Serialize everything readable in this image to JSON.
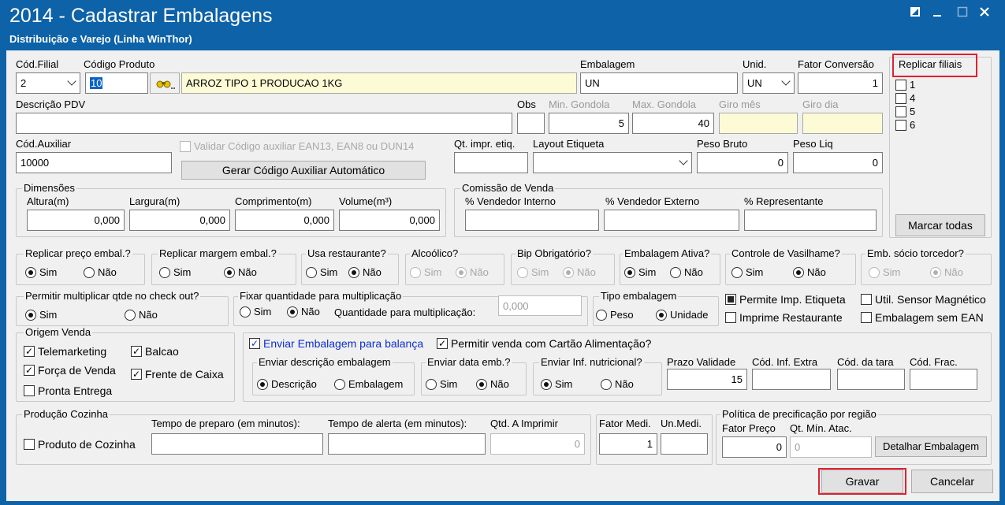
{
  "window": {
    "title": "2014 - Cadastrar Embalagens",
    "subtitle": "Distribuição e Varejo (Linha WinThor)"
  },
  "top": {
    "cod_filial_label": "Cód.Filial",
    "cod_filial_value": "2",
    "codigo_produto_label": "Código Produto",
    "codigo_produto_value": "10",
    "produto_descricao": "ARROZ TIPO 1 PRODUCAO 1KG",
    "embalagem_label": "Embalagem",
    "embalagem_value": "UN",
    "unid_label": "Unid.",
    "unid_value": "UN",
    "fator_conversao_label": "Fator Conversão",
    "fator_conversao_value": "1"
  },
  "replicar_filiais": {
    "label": "Replicar filiais",
    "filiais": [
      "1",
      "4",
      "5",
      "6"
    ],
    "marcar_todas": "Marcar todas"
  },
  "row2": {
    "descricao_pdv_label": "Descrição PDV",
    "descricao_pdv_value": "",
    "obs_label": "Obs",
    "min_gondola_label": "Min. Gondola",
    "min_gondola_value": "5",
    "max_gondola_label": "Max. Gondola",
    "max_gondola_value": "40",
    "giro_mes_label": "Giro mês",
    "giro_dia_label": "Giro dia"
  },
  "row3": {
    "cod_auxiliar_label": "Cód.Auxiliar",
    "cod_auxiliar_value": "10000",
    "validar_label": "Validar Código auxiliar EAN13, EAN8 ou DUN14",
    "gerar_button": "Gerar Código Auxiliar Automático",
    "qt_impr_label": "Qt. impr. etiq.",
    "layout_etiqueta_label": "Layout Etiqueta",
    "peso_bruto_label": "Peso Bruto",
    "peso_bruto_value": "0",
    "peso_liq_label": "Peso Liq",
    "peso_liq_value": "0"
  },
  "dimensoes": {
    "title": "Dimensões",
    "altura_label": "Altura(m)",
    "altura_value": "0,000",
    "largura_label": "Largura(m)",
    "largura_value": "0,000",
    "comprimento_label": "Comprimento(m)",
    "comprimento_value": "0,000",
    "volume_label": "Volume(m³)",
    "volume_value": "0,000"
  },
  "comissao": {
    "title": "Comissão de Venda",
    "vend_interno_label": "% Vendedor Interno",
    "vend_externo_label": "% Vendedor Externo",
    "representante_label": "% Representante"
  },
  "options": {
    "sim": "Sim",
    "nao": "Não",
    "replicar_preco": "Replicar preço embal.?",
    "replicar_margem": "Replicar margem embal.?",
    "usa_restaurante": "Usa restaurante?",
    "alcoolico": "Alcoólico?",
    "bip_obrigatorio": "Bip Obrigatório?",
    "embalagem_ativa": "Embalagem Ativa?",
    "controle_vasilhame": "Controle de Vasilhame?",
    "emb_socio_torcedor": "Emb. sócio torcedor?",
    "permitir_multiplicar": "Permitir multiplicar qtde no check out?",
    "fixar_quantidade": "Fixar quantidade para multiplicação",
    "quantidade_multiplicacao_label": "Quantidade para multiplicação:",
    "quantidade_multiplicacao_value": "0,000",
    "tipo_embalagem": "Tipo embalagem",
    "peso": "Peso",
    "unidade": "Unidade",
    "permite_imp_etiqueta": "Permite Imp. Etiqueta",
    "util_sensor": "Util. Sensor Magnético",
    "imprime_restaurante": "Imprime Restaurante",
    "embalagem_sem_ean": "Embalagem sem EAN"
  },
  "origem_venda": {
    "title": "Origem Venda",
    "telemarketing": "Telemarketing",
    "balcao": "Balcao",
    "forca_venda": "Força de Venda",
    "frente_caixa": "Frente de Caixa",
    "pronta_entrega": "Pronta Entrega"
  },
  "balanca": {
    "enviar_embalagem": "Enviar Embalagem para balança",
    "permitir_cartao": "Permitir venda com Cartão Alimentação?",
    "enviar_descricao": "Enviar descrição embalagem",
    "descricao": "Descrição",
    "embalagem": "Embalagem",
    "enviar_data": "Enviar data emb.?",
    "enviar_nutricional": "Enviar Inf. nutricional?",
    "prazo_validade_label": "Prazo Validade",
    "prazo_validade_value": "15",
    "cod_inf_extra_label": "Cód. Inf. Extra",
    "cod_tara_label": "Cód. da tara",
    "cod_frac_label": "Cód. Frac."
  },
  "producao": {
    "title": "Produção Cozinha",
    "produto_cozinha": "Produto de Cozinha",
    "tempo_preparo_label": "Tempo de preparo (em minutos):",
    "tempo_alerta_label": "Tempo de alerta (em minutos):",
    "qtd_imprimir_label": "Qtd. A Imprimir",
    "qtd_imprimir_value": "0",
    "fator_medi_label": "Fator Medi.",
    "fator_medi_value": "1",
    "un_medi_label": "Un.Medi."
  },
  "politica": {
    "title": "Política de precificação por região",
    "fator_preco_label": "Fator Preço",
    "fator_preco_value": "0",
    "qt_min_atac_label": "Qt. Mín. Atac.",
    "qt_min_atac_value": "0",
    "detalhar_button": "Detalhar Embalagem"
  },
  "footer": {
    "gravar": "Gravar",
    "cancelar": "Cancelar"
  }
}
